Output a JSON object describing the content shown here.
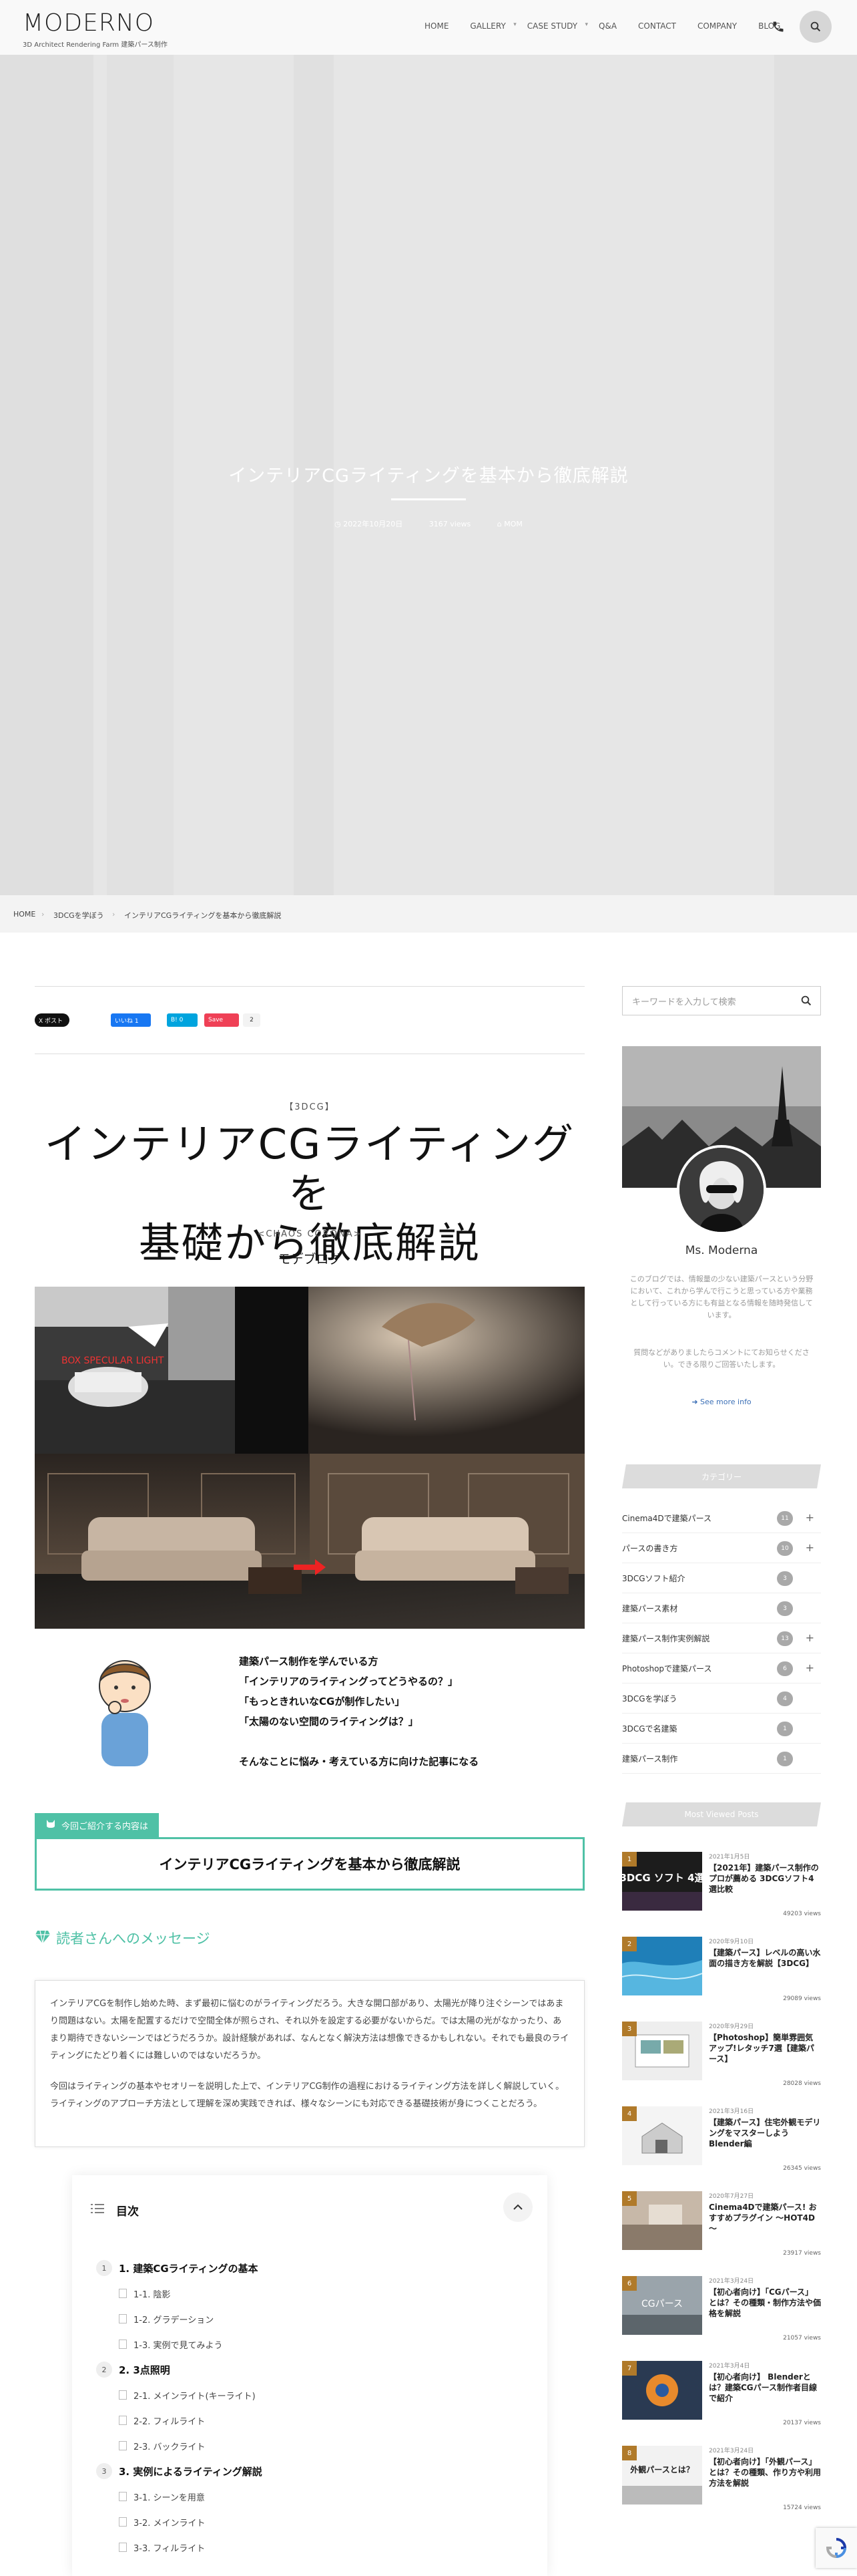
{
  "header": {
    "logo": "MODERNO",
    "logo_sub": "3D Architect Rendering Farm 建築パース制作",
    "nav": [
      {
        "label": "HOME",
        "dropdown": false
      },
      {
        "label": "GALLERY",
        "dropdown": true
      },
      {
        "label": "CASE STUDY",
        "dropdown": true
      },
      {
        "label": "Q&A",
        "dropdown": false
      },
      {
        "label": "CONTACT",
        "dropdown": false
      },
      {
        "label": "COMPANY",
        "dropdown": false
      },
      {
        "label": "BLOG",
        "dropdown": false
      }
    ]
  },
  "hero": {
    "title": "インテリアCGライティングを基本から徹底解説",
    "date": "2022年10月20日",
    "views": "3167 views",
    "author": "MOM"
  },
  "breadcrumb": [
    "HOME",
    "3DCGを学ぼう",
    "インテリアCGライティングを基本から徹底解説"
  ],
  "share": {
    "x_label": "X ポスト",
    "fb_label": "いいね 1",
    "hatena_label": "B! 0",
    "pocket_label": "Save",
    "pocket_count": "2"
  },
  "lead": {
    "tag": "【3DCG】",
    "title_line1": "インテリアCGライティングを",
    "title_line2": "基礎から徹底解説",
    "sub": "<CHAOS CORONA>",
    "brand": "モデブログ",
    "image_label": "BOX SPECULAR LIGHT",
    "lines": [
      "建築パース制作を学んでいる方",
      "「インテリアのライティングってどうやるの？」",
      "「もっときれいなCGが制作したい」",
      "「太陽のない空間のライティングは？」",
      "",
      "そんなことに悩み・考えている方に向けた記事になる"
    ]
  },
  "intro": {
    "tag": "今回ご紹介する内容は",
    "box": "インテリアCGライティングを基本から徹底解説"
  },
  "message": {
    "heading": "読者さんへのメッセージ",
    "p1": "インテリアCGを制作し始めた時、まず最初に悩むのがライティングだろう。大きな開口部があり、太陽光が降り注ぐシーンではあまり問題はない。太陽を配置するだけで空間全体が照らされ、それ以外を設定する必要がないからだ。では太陽の光がなかったり、あまり期待できないシーンではどうだろうか。設計経験があれば、なんとなく解決方法は想像できるかもしれない。それでも最良のライティングにたどり着くには難しいのではないだろうか。",
    "p2": "今回はライティングの基本やセオリーを説明した上で、インテリアCG制作の過程におけるライティング方法を詳しく解説していく。ライティングのアプローチ方法として理解を深め実践できれば、様々なシーンにも対応できる基礎技術が身につくことだろう。"
  },
  "toc": {
    "heading": "目次",
    "items": [
      {
        "n": "1",
        "label": "1. 建築CGライティングの基本",
        "children": [
          "1-1. 陰影",
          "1-2. グラデーション",
          "1-3. 実例で見てみよう"
        ]
      },
      {
        "n": "2",
        "label": "2. 3点照明",
        "children": [
          "2-1. メインライト(キーライト)",
          "2-2. フィルライト",
          "2-3. バックライト"
        ]
      },
      {
        "n": "3",
        "label": "3. 実例によるライティング解説",
        "children": [
          "3-1. シーンを用意",
          "3-2. メインライト",
          "3-3. フィルライト"
        ]
      }
    ]
  },
  "sidebar": {
    "search_placeholder": "キーワードを入力して検索",
    "profile": {
      "name": "Ms. Moderna",
      "desc": "このブログでは、情報量の少ない建築パースという分野において、これから学んで行こうと思っている方や業務として行っている方にも有益となる情報を随時発信しています。",
      "ask": "質問などがありましたらコメントにてお知らせください。できる限りご回答いたします。",
      "more": "See more info"
    },
    "cat_heading": "カテゴリー",
    "categories": [
      {
        "label": "Cinema4Dで建築パース",
        "count": "11",
        "plus": true
      },
      {
        "label": "パースの書き方",
        "count": "10",
        "plus": true
      },
      {
        "label": "3DCGソフト紹介",
        "count": "3",
        "plus": false
      },
      {
        "label": "建築パース素材",
        "count": "3",
        "plus": false
      },
      {
        "label": "建築パース制作実例解説",
        "count": "13",
        "plus": true
      },
      {
        "label": "Photoshopで建築パース",
        "count": "6",
        "plus": true
      },
      {
        "label": "3DCGを学ぼう",
        "count": "4",
        "plus": false
      },
      {
        "label": "3DCGで名建築",
        "count": "1",
        "plus": false
      },
      {
        "label": "建築パース制作",
        "count": "1",
        "plus": false
      }
    ],
    "pop_heading": "Most Viewed Posts",
    "popular": [
      {
        "rank": "1",
        "date": "2021年1月5日",
        "title": "【2021年】建築パース制作のプロが薦める 3DCGソフト4選比較",
        "views": "49203 views",
        "thumb_text": "3DCG ソフト 4選"
      },
      {
        "rank": "2",
        "date": "2020年9月10日",
        "title": "【建築パース】レベルの高い水面の描き方を解説【3DCG】",
        "views": "29089 views",
        "thumb_text": ""
      },
      {
        "rank": "3",
        "date": "2020年9月29日",
        "title": "【Photoshop】簡単雰囲気アップ!レタッチ7選【建築パース】",
        "views": "28028 views",
        "thumb_text": ""
      },
      {
        "rank": "4",
        "date": "2021年3月16日",
        "title": "【建築パース】住宅外観モデリングをマスターしよう Blender編",
        "views": "26345 views",
        "thumb_text": ""
      },
      {
        "rank": "5",
        "date": "2020年7月27日",
        "title": "Cinema4Dで建築パース! おすすめプラグイン ～HOT4D～",
        "views": "23917 views",
        "thumb_text": ""
      },
      {
        "rank": "6",
        "date": "2021年3月24日",
        "title": "【初心者向け】「CGパース」とは？その種類・制作方法や価格を解説",
        "views": "21057 views",
        "thumb_text": "CGパース"
      },
      {
        "rank": "7",
        "date": "2021年3月4日",
        "title": "【初心者向け】 Blenderとは？建築CGパース制作者目線で紹介",
        "views": "20137 views",
        "thumb_text": ""
      },
      {
        "rank": "8",
        "date": "2021年3月24日",
        "title": "【初心者向け】「外観パース」とは？その種類、作り方や利用方法を解説",
        "views": "15724 views",
        "thumb_text": "外観パースとは？"
      }
    ]
  },
  "colors": {
    "accent": "#4fc1a6",
    "link": "#3b6fb6"
  }
}
